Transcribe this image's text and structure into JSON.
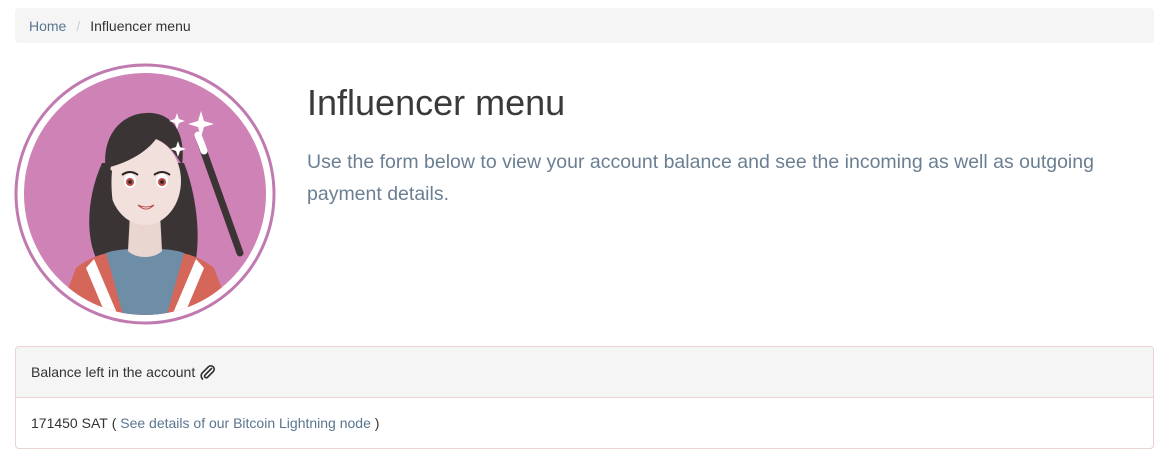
{
  "breadcrumb": {
    "home": "Home",
    "separator": "/",
    "current": "Influencer menu"
  },
  "hero": {
    "title": "Influencer menu",
    "description": "Use the form below to view your account balance and see the incoming as well as outgoing payment details."
  },
  "balance_panel": {
    "heading": "Balance left in the account",
    "heading_icon": "paperclip-icon",
    "amount": "171450 SAT",
    "paren_open": "(",
    "link_text": "See details of our Bitcoin Lightning node",
    "paren_close": ")"
  },
  "colors": {
    "avatar_background": "#cf82b6",
    "avatar_ring": "#c07ab0",
    "link": "#5a7590",
    "panel_border": "#ead3d0"
  }
}
